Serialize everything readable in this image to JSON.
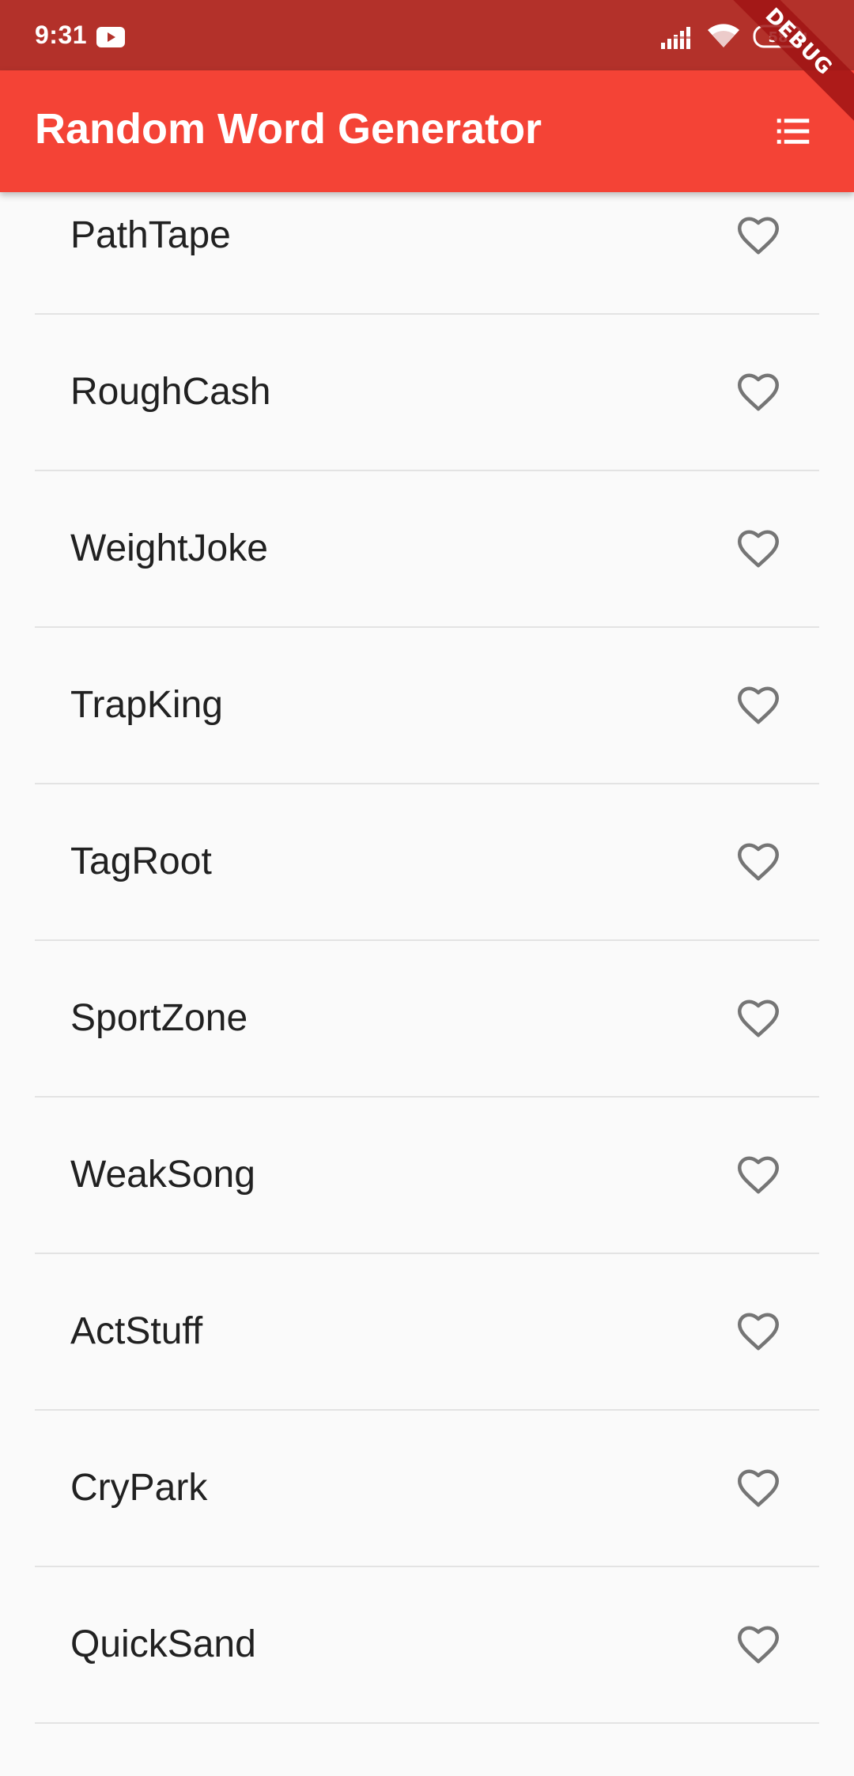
{
  "status_bar": {
    "time": "9:31",
    "battery": "58",
    "background_color": "#b3312a",
    "icons": [
      "youtube-icon",
      "signal-icon",
      "wifi-icon",
      "battery-icon"
    ]
  },
  "app_bar": {
    "title": "Random Word Generator",
    "background_color": "#f44336",
    "action_icon": "list-icon"
  },
  "debug_banner": {
    "label": "DEBUG"
  },
  "words": [
    {
      "label": "PathTape",
      "favorited": false
    },
    {
      "label": "RoughCash",
      "favorited": false
    },
    {
      "label": "WeightJoke",
      "favorited": false
    },
    {
      "label": "TrapKing",
      "favorited": false
    },
    {
      "label": "TagRoot",
      "favorited": false
    },
    {
      "label": "SportZone",
      "favorited": false
    },
    {
      "label": "WeakSong",
      "favorited": false
    },
    {
      "label": "ActStuff",
      "favorited": false
    },
    {
      "label": "CryPark",
      "favorited": false
    },
    {
      "label": "QuickSand",
      "favorited": false
    }
  ],
  "colors": {
    "heart_outline": "#757575",
    "divider": "#e3e3e3",
    "text": "#212121"
  }
}
